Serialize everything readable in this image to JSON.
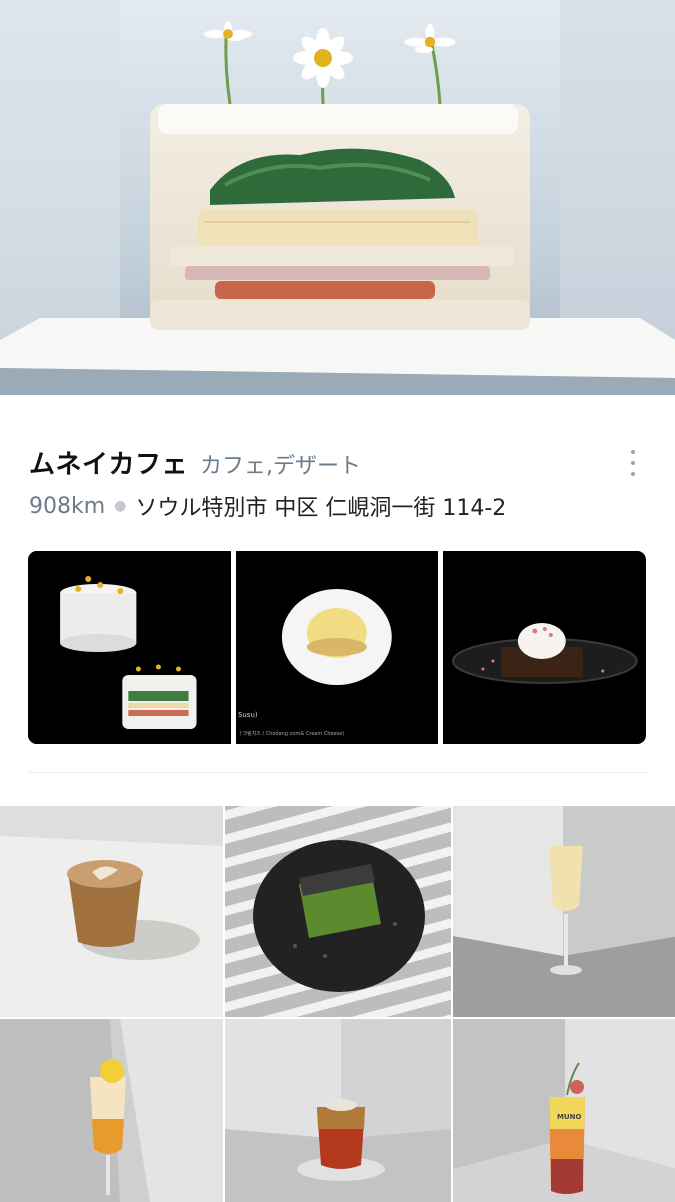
{
  "place": {
    "name": "ムネイカフェ",
    "category": "カフェ,デザート",
    "distance": "908km",
    "address": "ソウル特別市 中区 仁峴洞一街 114-2"
  },
  "thumbnails": {
    "menu_caption": "Susu)",
    "menu_subcaption": "ㅏ크림치즈 / Chodang corn& Cream Cheese)"
  },
  "grid_photos": {
    "cocktail_label": "MUNO"
  },
  "icons": {
    "more": "more-vertical-icon"
  }
}
